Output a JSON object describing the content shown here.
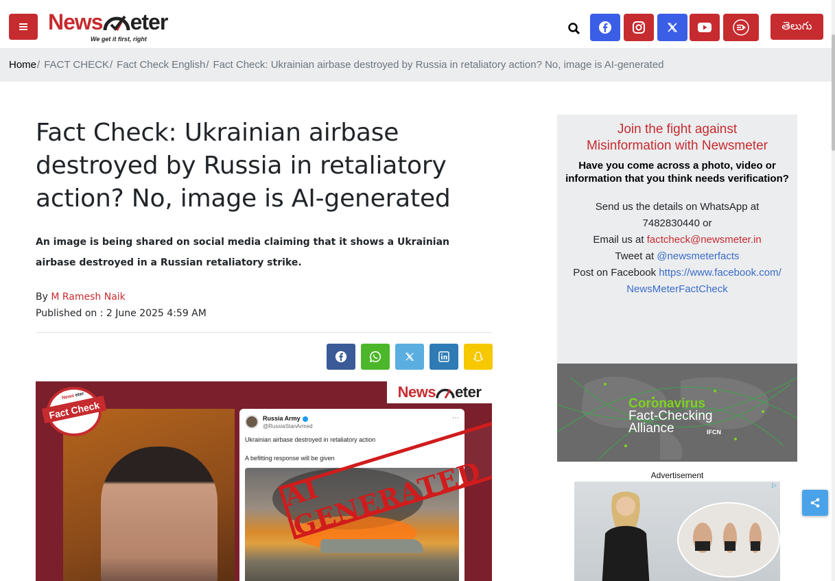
{
  "header": {
    "menu_icon": "hamburger-icon",
    "logo": {
      "part1": "News",
      "part2": "eter",
      "tagline": "We get it first, right"
    },
    "search_icon": "search-icon",
    "social": [
      {
        "name": "facebook",
        "icon": "facebook-icon",
        "color": "#3b5ee6"
      },
      {
        "name": "instagram",
        "icon": "instagram-icon",
        "color": "#c62b2f"
      },
      {
        "name": "x",
        "icon": "x-icon",
        "color": "#3b5ee6"
      },
      {
        "name": "youtube",
        "icon": "youtube-icon",
        "color": "#c62b2f"
      },
      {
        "name": "video",
        "icon": "video-icon",
        "color": "#c62b2f"
      }
    ],
    "language_label": "తెలుగు"
  },
  "breadcrumb": [
    {
      "label": "Home"
    },
    {
      "label": "FACT CHECK"
    },
    {
      "label": "Fact Check English"
    },
    {
      "label": "Fact Check: Ukrainian airbase destroyed by Russia in retaliatory action? No, image is AI-generated"
    }
  ],
  "breadcrumb_sep": "/",
  "article": {
    "title": "Fact Check: Ukrainian airbase destroyed by Russia in retaliatory action? No, image is AI-generated",
    "summary": "An image is being shared on social media claiming that it shows a Ukrainian airbase destroyed in a Russian retaliatory strike.",
    "by_prefix": "By",
    "author": "M Ramesh Naik",
    "published": "Published on : 2 June 2025 4:59 AM",
    "share_buttons": [
      {
        "name": "facebook",
        "icon": "facebook-icon",
        "color": "#3a5a98"
      },
      {
        "name": "whatsapp",
        "icon": "whatsapp-icon",
        "color": "#4cb72a"
      },
      {
        "name": "x",
        "icon": "x-icon",
        "color": "#5aaee0"
      },
      {
        "name": "linkedin",
        "icon": "linkedin-icon",
        "color": "#2f7bb5"
      },
      {
        "name": "snapchat",
        "icon": "snapchat-icon",
        "color": "#f5c800"
      }
    ]
  },
  "featured_image": {
    "stamp": {
      "top": "News",
      "top2": "eter",
      "main": "Fact Check"
    },
    "watermark": {
      "part1": "News",
      "part2": "eter"
    },
    "tweet": {
      "name": "Russia Army",
      "handle": "@RussiaStanArmed",
      "line1": "Ukrainian airbase destroyed in retaliatory action",
      "line2": "A befitting response will be given",
      "more": "⋯"
    },
    "stamp_text": "AI GENERATED"
  },
  "sidebar": {
    "promo": {
      "heading_line1": "Join the fight against",
      "heading_line2": "Misinformation with Newsmeter",
      "question": "Have you come across a photo, video or information that you think needs verification?",
      "whatsapp_line1": "Send us the details on WhatsApp at",
      "whatsapp_line2": "7482830440 or",
      "email_prefix": "Email us at",
      "email": "factcheck@newsmeter.in",
      "tweet_prefix": "Tweet at",
      "twitter": "@newsmeterfacts",
      "facebook_prefix": "Post on Facebook",
      "facebook_url_line1": "https://www.facebook.com/",
      "facebook_url_line2": "NewsMeterFactCheck"
    },
    "cfca": {
      "line1": "Coronavirus",
      "line2": "Fact-Checking",
      "line3": "Alliance",
      "badge": "IFCN"
    },
    "ad_label": "Advertisement"
  },
  "floating_share_icon": "share-icon",
  "colors": {
    "brand_red": "#c62b2f",
    "link_blue": "#3b6cc9",
    "breadcrumb_bg": "#ebedef"
  }
}
